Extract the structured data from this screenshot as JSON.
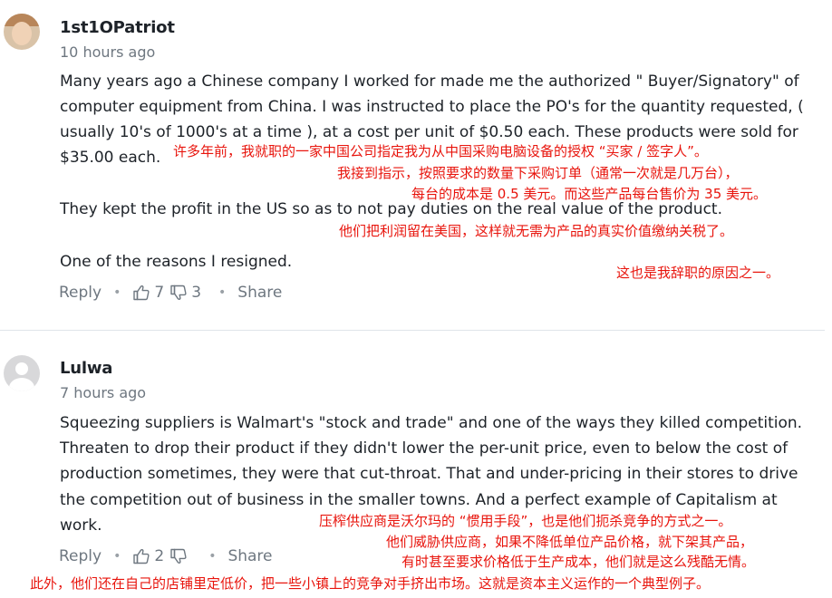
{
  "comments": [
    {
      "username": "1st1OPatriot",
      "timestamp": "10 hours ago",
      "paragraphs": [
        [
          "Many years ago a Chinese company I worked for made me the authorized \" Buyer/Signatory\" of",
          "computer equipment from China.  I was instructed to place the PO's for the quantity requested, (",
          "usually 10's of 1000's at a time ), at a cost per unit of $0.50 each. These products were sold for",
          "$35.00 each."
        ],
        [
          "They kept the profit in the US so as to not pay duties on the real value of the product."
        ],
        [
          "One of the reasons I resigned."
        ]
      ],
      "reply_label": "Reply",
      "upvotes": "7",
      "downvotes": "3",
      "share_label": "Share",
      "translation": [
        "许多年前，我就职的一家中国公司指定我为从中国采购电脑设备的授权 “买家 / 签字人”。",
        "我接到指示，按照要求的数量下采购订单（通常一次就是几万台），",
        "每台的成本是 0.5 美元。而这些产品每台售价为 35 美元。",
        "他们把利润留在美国，这样就无需为产品的真实价值缴纳关税了。",
        "这也是我辞职的原因之一。"
      ]
    },
    {
      "username": "Lulwa",
      "timestamp": "7 hours ago",
      "paragraphs": [
        [
          "Squeezing suppliers is Walmart's \"stock and trade\" and one of the ways they  killed competition.",
          "Threaten to drop their product if they didn't lower the per-unit price, even to below the cost of",
          "production sometimes, they were that cut-throat. That and under-pricing in their stores to drive",
          "the competition out of business in the smaller towns. And a perfect example of Capitalism at",
          "work."
        ]
      ],
      "reply_label": "Reply",
      "upvotes": "2",
      "downvotes": "",
      "share_label": "Share",
      "translation": [
        "压榨供应商是沃尔玛的 “惯用手段”，也是他们扼杀竞争的方式之一。",
        "他们威胁供应商，如果不降低单位产品价格，就下架其产品，",
        "有时甚至要求价格低于生产成本，他们就是这么残酷无情。",
        "此外，他们还在自己的店铺里定低价，把一些小镇上的竞争对手挤出市场。这就是资本主义运作的一个典型例子。"
      ]
    }
  ],
  "icons": {
    "upvote": "thumbs-up-icon",
    "downvote": "thumbs-down-icon"
  },
  "colors": {
    "text": "#1d2228",
    "muted": "#6e7780",
    "translation": "#e8140c",
    "divider": "#e0e4e9"
  }
}
